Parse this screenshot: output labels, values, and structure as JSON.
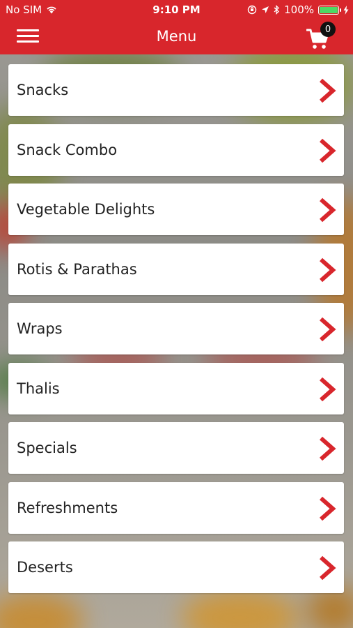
{
  "status_bar": {
    "carrier": "No SIM",
    "time": "9:10 PM",
    "battery_percent": "100%",
    "battery_level": 1.0,
    "battery_color": "#4cd964"
  },
  "header": {
    "title": "Menu",
    "menu_icon": "hamburger-icon",
    "cart_icon": "cart-icon",
    "cart_count": "0",
    "color": "#d8262c"
  },
  "menu": {
    "arrow_icon": "chevron-right-icon",
    "accent": "#d8262c",
    "items": [
      {
        "label": "Snacks"
      },
      {
        "label": "Snack Combo"
      },
      {
        "label": "Vegetable Delights"
      },
      {
        "label": "Rotis & Parathas"
      },
      {
        "label": "Wraps"
      },
      {
        "label": "Thalis"
      },
      {
        "label": "Specials"
      },
      {
        "label": "Refreshments"
      },
      {
        "label": "Deserts"
      }
    ]
  }
}
